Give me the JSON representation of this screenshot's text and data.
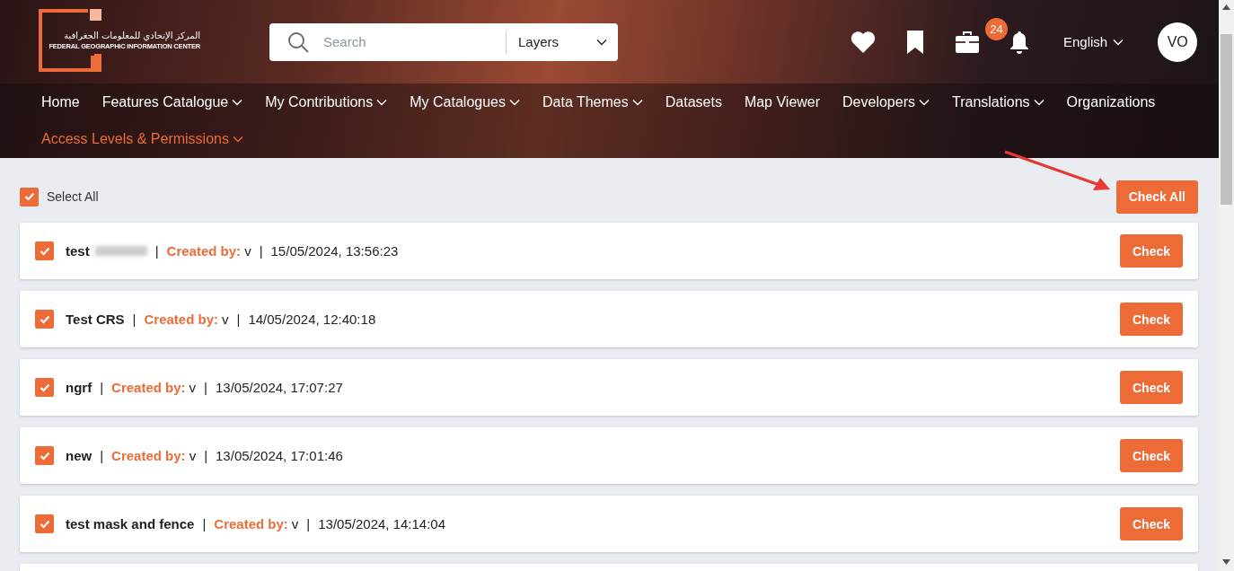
{
  "logo": {
    "arabic": "المركز الإتحادي للمعلومات الجغرافية",
    "english": "FEDERAL GEOGRAPHIC INFORMATION CENTER"
  },
  "search": {
    "placeholder": "Search",
    "scope": "Layers"
  },
  "notifications": {
    "count": "24"
  },
  "language": "English",
  "avatar": "VO",
  "nav": [
    {
      "label": "Home",
      "dropdown": false,
      "selected": false
    },
    {
      "label": "Features Catalogue",
      "dropdown": true,
      "selected": false
    },
    {
      "label": "My Contributions",
      "dropdown": true,
      "selected": false
    },
    {
      "label": "My Catalogues",
      "dropdown": true,
      "selected": false
    },
    {
      "label": "Data Themes",
      "dropdown": true,
      "selected": false
    },
    {
      "label": "Datasets",
      "dropdown": false,
      "selected": false
    },
    {
      "label": "Map Viewer",
      "dropdown": false,
      "selected": false
    },
    {
      "label": "Developers",
      "dropdown": true,
      "selected": false
    },
    {
      "label": "Translations",
      "dropdown": true,
      "selected": false
    },
    {
      "label": "Organizations",
      "dropdown": false,
      "selected": false
    },
    {
      "label": "Access Levels & Permissions",
      "dropdown": true,
      "selected": true
    }
  ],
  "select_all": {
    "label": "Select All",
    "checked": true
  },
  "check_all_button": "Check All",
  "separator": "|",
  "items": [
    {
      "name": "test",
      "redacted": true,
      "created_by_label": "Created by:",
      "created_by": "v",
      "date": "15/05/2024, 13:56:23",
      "checked": true,
      "button": "Check"
    },
    {
      "name": "Test CRS",
      "redacted": false,
      "created_by_label": "Created by:",
      "created_by": "v",
      "date": "14/05/2024, 12:40:18",
      "checked": true,
      "button": "Check"
    },
    {
      "name": "ngrf",
      "redacted": false,
      "created_by_label": "Created by:",
      "created_by": "v",
      "date": "13/05/2024, 17:07:27",
      "checked": true,
      "button": "Check"
    },
    {
      "name": "new",
      "redacted": false,
      "created_by_label": "Created by:",
      "created_by": "v",
      "date": "13/05/2024, 17:01:46",
      "checked": true,
      "button": "Check"
    },
    {
      "name": "test mask and fence",
      "redacted": false,
      "created_by_label": "Created by:",
      "created_by": "v",
      "date": "13/05/2024, 14:14:04",
      "checked": true,
      "button": "Check"
    }
  ]
}
